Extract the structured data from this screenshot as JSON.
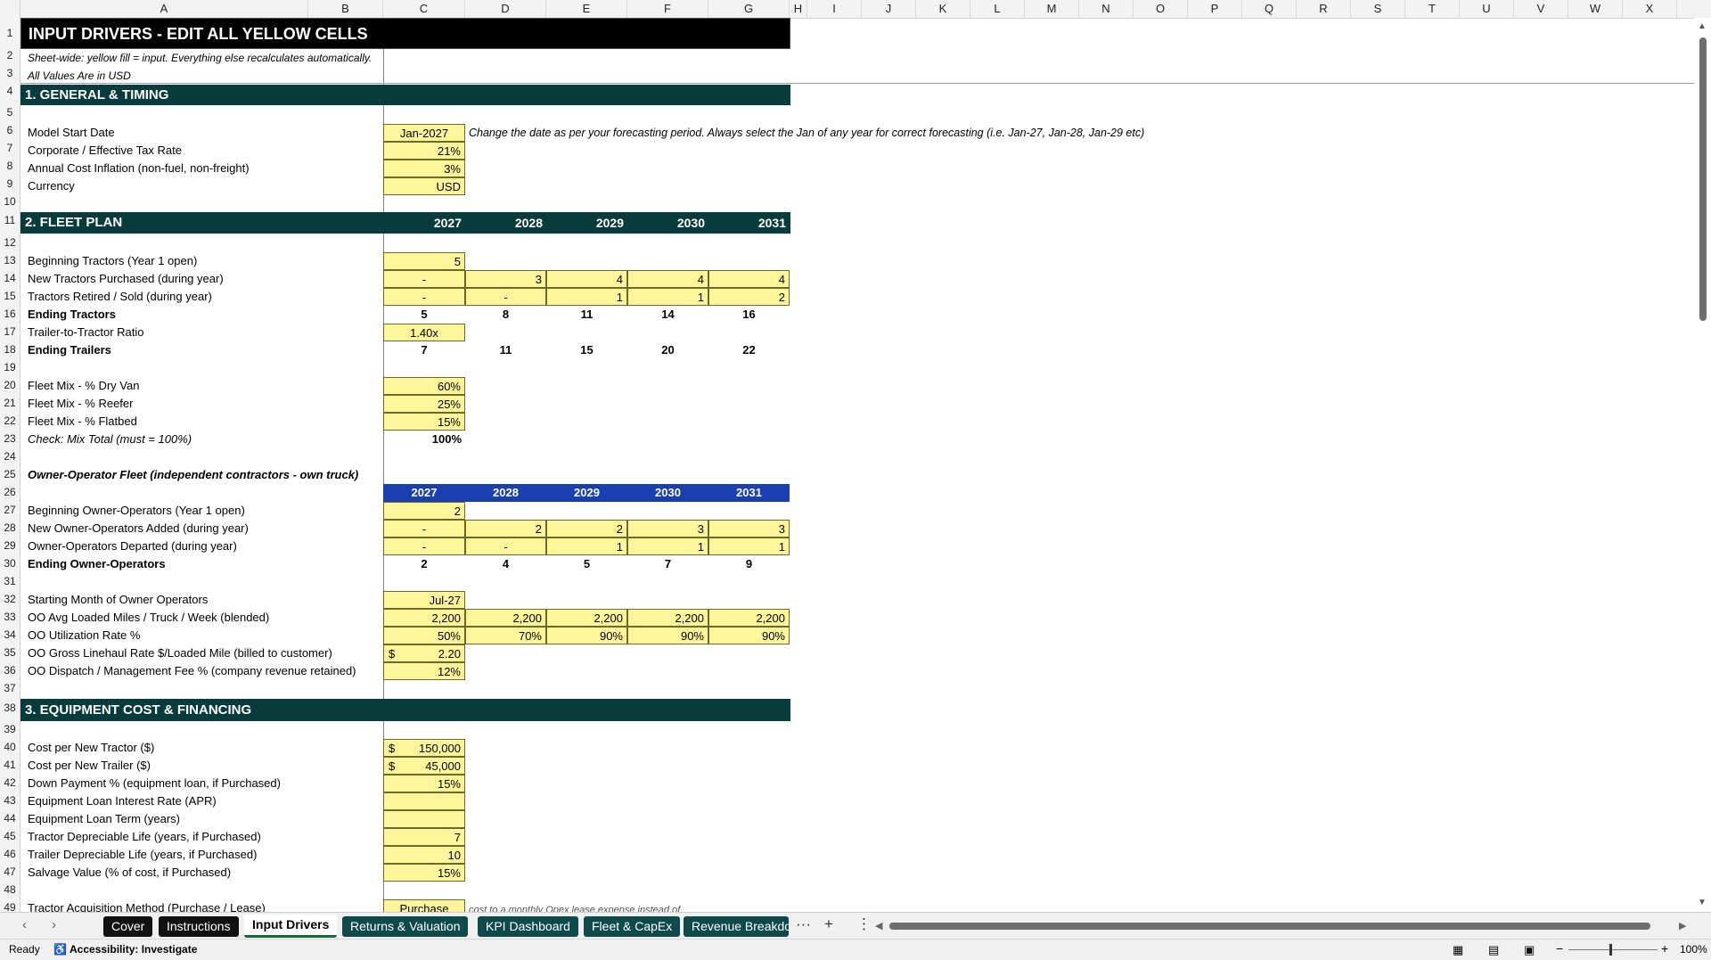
{
  "columns": [
    "A",
    "B",
    "C",
    "D",
    "E",
    "F",
    "G",
    "H",
    "I",
    "J",
    "K",
    "L",
    "M",
    "N",
    "O",
    "P",
    "Q",
    "R",
    "S",
    "T",
    "U",
    "V",
    "W",
    "X"
  ],
  "rows": [
    "1",
    "2",
    "3",
    "4",
    "5",
    "6",
    "7",
    "8",
    "9",
    "10",
    "11",
    "12",
    "13",
    "14",
    "15",
    "16",
    "17",
    "18",
    "19",
    "20",
    "21",
    "22",
    "23",
    "24",
    "25",
    "26",
    "27",
    "28",
    "29",
    "30",
    "31",
    "32",
    "33",
    "34",
    "35",
    "36",
    "37",
    "38",
    "39",
    "40",
    "41",
    "42",
    "43",
    "44",
    "45",
    "46",
    "47",
    "48",
    "49"
  ],
  "title": "INPUT DRIVERS - EDIT ALL YELLOW CELLS",
  "notes": {
    "sheet_wide": "Sheet-wide: yellow fill = input. Everything else recalculates automatically.",
    "usd": "All Values Are in USD",
    "date_hint": "Change the date as per your forecasting period. Always select the Jan of any year for correct forecasting (i.e. Jan-27, Jan-28, Jan-29 etc)",
    "lease_hint": "cost to a monthly Opex lease expense instead of"
  },
  "sections": {
    "general": "1.  GENERAL & TIMING",
    "fleet": "2.  FLEET PLAN",
    "equipment": "3.  EQUIPMENT COST & FINANCING"
  },
  "years": [
    "2027",
    "2028",
    "2029",
    "2030",
    "2031"
  ],
  "general": {
    "start_label": "Model Start Date",
    "start_value": "Jan-2027",
    "tax_label": "Corporate / Effective Tax Rate",
    "tax_value": "21%",
    "infl_label": "Annual Cost Inflation (non-fuel, non-freight)",
    "infl_value": "3%",
    "cur_label": "Currency",
    "cur_value": "USD"
  },
  "fleet": {
    "beg_label": "Beginning Tractors (Year 1 open)",
    "beg_value": "5",
    "new_label": "New Tractors Purchased (during year)",
    "new_values": [
      "-",
      "3",
      "4",
      "4",
      "4"
    ],
    "ret_label": "Tractors Retired / Sold (during year)",
    "ret_values": [
      "-",
      "-",
      "1",
      "1",
      "2"
    ],
    "end_label": "Ending Tractors",
    "end_values": [
      "5",
      "8",
      "11",
      "14",
      "16"
    ],
    "ratio_label": "Trailer-to-Tractor Ratio",
    "ratio_value": "1.40x",
    "trl_label": "Ending Trailers",
    "trl_values": [
      "7",
      "11",
      "15",
      "20",
      "22"
    ],
    "dry_label": "Fleet Mix - % Dry Van",
    "dry_value": "60%",
    "reefer_label": "Fleet Mix - % Reefer",
    "reefer_value": "25%",
    "flat_label": "Fleet Mix - % Flatbed",
    "flat_value": "15%",
    "check_label": "Check: Mix Total (must = 100%)",
    "check_value": "100%"
  },
  "oo": {
    "heading": "Owner-Operator Fleet (independent contractors - own truck)",
    "beg_label": "Beginning Owner-Operators (Year 1 open)",
    "beg_value": "2",
    "add_label": "New Owner-Operators Added (during year)",
    "add_values": [
      "-",
      "2",
      "2",
      "3",
      "3"
    ],
    "dep_label": "Owner-Operators Departed (during year)",
    "dep_values": [
      "-",
      "-",
      "1",
      "1",
      "1"
    ],
    "end_label": "Ending Owner-Operators",
    "end_values": [
      "2",
      "4",
      "5",
      "7",
      "9"
    ],
    "start_label": "Starting Month of Owner Operators",
    "start_value": "Jul-27",
    "miles_label": "OO Avg Loaded Miles / Truck / Week (blended)",
    "miles_values": [
      "2,200",
      "2,200",
      "2,200",
      "2,200",
      "2,200"
    ],
    "util_label": "OO Utilization Rate %",
    "util_values": [
      "50%",
      "70%",
      "90%",
      "90%",
      "90%"
    ],
    "rate_label": "OO Gross Linehaul Rate $/Loaded Mile (billed to customer)",
    "rate_currency": "$",
    "rate_value": "2.20",
    "fee_label": "OO Dispatch / Management Fee % (company revenue retained)",
    "fee_value": "12%"
  },
  "equipment": {
    "tractor_label": "Cost per New Tractor ($)",
    "tractor_currency": "$",
    "tractor_value": "150,000",
    "trailer_label": "Cost per New Trailer ($)",
    "trailer_currency": "$",
    "trailer_value": "45,000",
    "down_label": "Down Payment % (equipment loan, if Purchased)",
    "down_value": "15%",
    "apr_label": "Equipment Loan Interest Rate (APR)",
    "apr_value": "",
    "term_label": "Equipment Loan Term (years)",
    "term_value": "",
    "tlife_label": "Tractor Depreciable Life (years, if Purchased)",
    "tlife_value": "7",
    "trlife_label": "Trailer Depreciable Life (years, if Purchased)",
    "trlife_value": "10",
    "salvage_label": "Salvage Value (% of cost, if Purchased)",
    "salvage_value": "15%",
    "method_label": "Tractor Acquisition Method (Purchase / Lease)",
    "method_value": "Purchase"
  },
  "tabs": [
    {
      "label": "Cover",
      "style": "dark"
    },
    {
      "label": "Instructions",
      "style": "dark"
    },
    {
      "label": "Input Drivers",
      "style": "active"
    },
    {
      "label": "Returns & Valuation",
      "style": "teal"
    },
    {
      "label": "KPI Dashboard",
      "style": "teal"
    },
    {
      "label": "Fleet & CapEx",
      "style": "teal"
    },
    {
      "label": "Revenue Breakdo",
      "style": "teal"
    }
  ],
  "tab_more": "···",
  "tab_add": "+",
  "tab_menu": "⋮",
  "status": {
    "ready": "Ready",
    "accessibility": "Accessibility: Investigate",
    "zoom": "100%",
    "zoom_minus": "−",
    "zoom_plus": "+"
  },
  "colors": {
    "input_fill": "#fff59b",
    "section_bar": "#083c3c",
    "oo_year_bar": "#1a3fb0",
    "title_bar": "#000000",
    "active_tab_underline": "#0e6b3a"
  }
}
